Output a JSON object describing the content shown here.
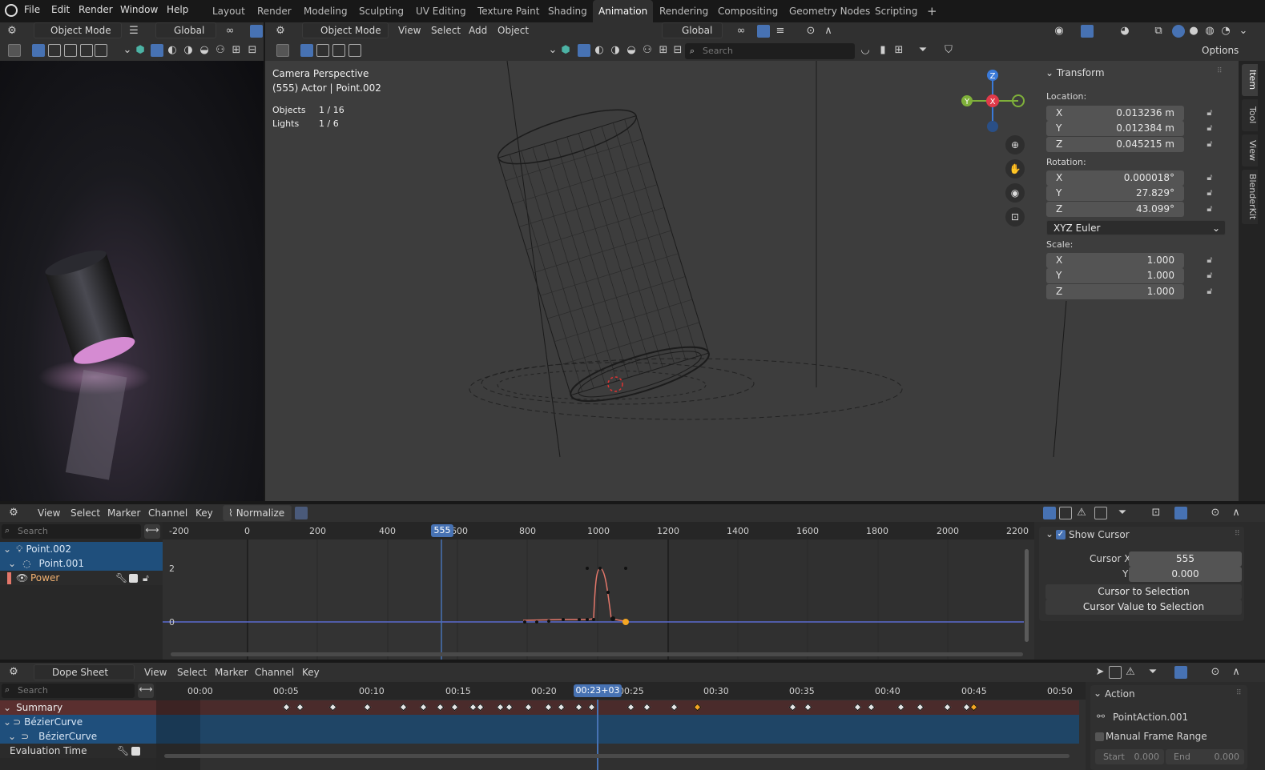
{
  "menu": {
    "items": [
      "File",
      "Edit",
      "Render",
      "Window",
      "Help"
    ]
  },
  "workspaces": [
    "Layout",
    "Render",
    "Modeling",
    "Sculpting",
    "UV Editing",
    "Texture Paint",
    "Shading",
    "Animation",
    "Rendering",
    "Compositing",
    "Geometry Nodes",
    "Scripting"
  ],
  "workspace_add": "+",
  "left_editor": {
    "mode": "Object Mode",
    "transform": "Global"
  },
  "viewport": {
    "mode": "Object Mode",
    "menus": [
      "View",
      "Select",
      "Add",
      "Object"
    ],
    "transform": "Global",
    "search_placeholder": "Search",
    "options_label": "Options",
    "overlay_title": "Camera Perspective",
    "overlay_subtitle": "(555) Actor | Point.002",
    "stats": [
      {
        "label": "Objects",
        "value": "1 / 16"
      },
      {
        "label": "Lights",
        "value": "1 / 6"
      }
    ],
    "gizmo": {
      "x": "X",
      "y": "Y",
      "z": "Z"
    }
  },
  "npanel": {
    "section": "Transform",
    "location_label": "Location:",
    "rotation_label": "Rotation:",
    "scale_label": "Scale:",
    "location": [
      {
        "axis": "X",
        "value": "0.013236 m"
      },
      {
        "axis": "Y",
        "value": "0.012384 m"
      },
      {
        "axis": "Z",
        "value": "0.045215 m"
      }
    ],
    "rotation": [
      {
        "axis": "X",
        "value": "0.000018°"
      },
      {
        "axis": "Y",
        "value": "27.829°"
      },
      {
        "axis": "Z",
        "value": "43.099°"
      }
    ],
    "rotation_mode": "XYZ Euler",
    "scale": [
      {
        "axis": "X",
        "value": "1.000"
      },
      {
        "axis": "Y",
        "value": "1.000"
      },
      {
        "axis": "Z",
        "value": "1.000"
      }
    ],
    "tabs": [
      "Item",
      "Tool",
      "View",
      "BlenderKit"
    ]
  },
  "graph": {
    "menus": [
      "View",
      "Select",
      "Marker",
      "Channel",
      "Key"
    ],
    "normalize": "Normalize",
    "search_placeholder": "Search",
    "channels": [
      "Point.002",
      "Point.001",
      "Power"
    ],
    "ruler": [
      "-200",
      "0",
      "200",
      "400",
      "600",
      "800",
      "1000",
      "1200",
      "1400",
      "1600",
      "1800",
      "2000",
      "2200"
    ],
    "current_frame": "555",
    "y_labels": [
      "2",
      "0"
    ],
    "sidebar": {
      "show_cursor": "Show Cursor",
      "cursor_x_label": "Cursor X",
      "cursor_x": "555",
      "y_label": "Y",
      "y_value": "0.000",
      "btn1": "Cursor to Selection",
      "btn2": "Cursor Value to Selection"
    }
  },
  "dopesheet": {
    "mode": "Dope Sheet",
    "menus": [
      "View",
      "Select",
      "Marker",
      "Channel",
      "Key"
    ],
    "search_placeholder": "Search",
    "ruler": [
      "00:00",
      "00:05",
      "00:10",
      "00:15",
      "00:20",
      "00:25",
      "00:30",
      "00:35",
      "00:40",
      "00:45",
      "00:50"
    ],
    "current_time": "00:23+03",
    "channels": [
      "Summary",
      "BézierCurve",
      "BézierCurve",
      "Evaluation Time"
    ],
    "sidebar": {
      "section": "Action",
      "action_name": "PointAction.001",
      "manual_range": "Manual Frame Range",
      "start_label": "Start",
      "start_value": "0.000",
      "end_label": "End",
      "end_value": "0.000"
    }
  },
  "colors": {
    "accent": "#4772b3",
    "selected_key": "#f5a623",
    "summary_row": "#5a2f2f",
    "object_row": "#1f4f7c",
    "curve": "#e4776a"
  }
}
